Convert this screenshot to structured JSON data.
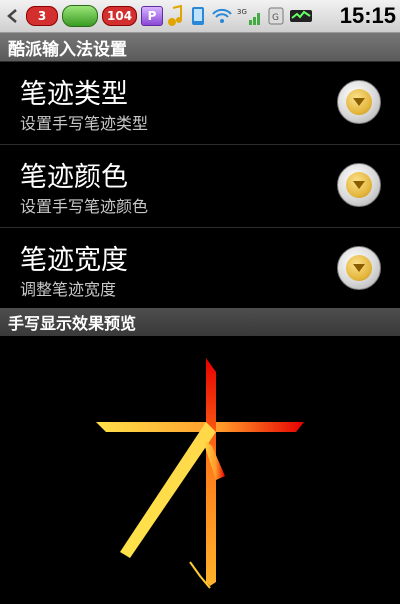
{
  "status_bar": {
    "notif_count": "3",
    "sms_count": "104",
    "p_label": "P",
    "signal_label": "3G",
    "time": "15:15",
    "icons": [
      "back-arrow-icon",
      "leaf-app-icon",
      "sms-icon",
      "p-app-icon",
      "music-note-icon",
      "sync-icon",
      "wifi-icon",
      "signal-icon",
      "battery-icon"
    ]
  },
  "title": "酷派输入法设置",
  "settings": [
    {
      "title": "笔迹类型",
      "subtitle": "设置手写笔迹类型"
    },
    {
      "title": "笔迹颜色",
      "subtitle": "设置手写笔迹颜色"
    },
    {
      "title": "笔迹宽度",
      "subtitle": "调整笔迹宽度"
    }
  ],
  "section_header": "手写显示效果预览",
  "preview": {
    "character": "木",
    "stroke_gradient": [
      "#ffe24a",
      "#ff9a2a",
      "#e60000"
    ]
  }
}
